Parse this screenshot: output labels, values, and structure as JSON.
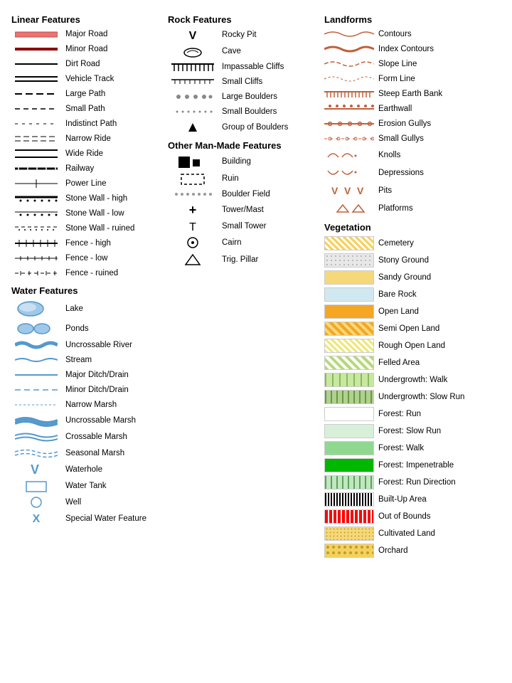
{
  "sections": {
    "linear": {
      "title": "Linear Features",
      "items": [
        {
          "label": "Major Road",
          "sym": "major-road"
        },
        {
          "label": "Minor Road",
          "sym": "minor-road"
        },
        {
          "label": "Dirt Road",
          "sym": "dirt-road"
        },
        {
          "label": "Vehicle Track",
          "sym": "vehicle-track"
        },
        {
          "label": "Large Path",
          "sym": "large-path"
        },
        {
          "label": "Small Path",
          "sym": "small-path"
        },
        {
          "label": "Indistinct Path",
          "sym": "indistinct-path"
        },
        {
          "label": "Narrow Ride",
          "sym": "narrow-ride"
        },
        {
          "label": "Wide Ride",
          "sym": "wide-ride"
        },
        {
          "label": "Railway",
          "sym": "railway"
        },
        {
          "label": "Power Line",
          "sym": "power-line"
        },
        {
          "label": "Stone Wall - high",
          "sym": "stone-high"
        },
        {
          "label": "Stone  Wall - low",
          "sym": "stone-low"
        },
        {
          "label": "Stone  Wall - ruined",
          "sym": "stone-ruined"
        },
        {
          "label": "Fence - high",
          "sym": "fence-high"
        },
        {
          "label": "Fence - low",
          "sym": "fence-low"
        },
        {
          "label": "Fence - ruined",
          "sym": "fence-ruined"
        }
      ]
    },
    "water": {
      "title": "Water Features",
      "items": [
        {
          "label": "Lake",
          "sym": "lake"
        },
        {
          "label": "Ponds",
          "sym": "ponds"
        },
        {
          "label": "Uncrossable River",
          "sym": "uncross-river"
        },
        {
          "label": "Stream",
          "sym": "stream"
        },
        {
          "label": "Major Ditch/Drain",
          "sym": "major-ditch"
        },
        {
          "label": "Minor Ditch/Drain",
          "sym": "minor-ditch"
        },
        {
          "label": "Narrow Marsh",
          "sym": "narrow-marsh"
        },
        {
          "label": "Uncrossable Marsh",
          "sym": "uncross-marsh"
        },
        {
          "label": "Crossable Marsh",
          "sym": "cross-marsh"
        },
        {
          "label": "Seasonal Marsh",
          "sym": "seasonal-marsh"
        },
        {
          "label": "Waterhole",
          "sym": "waterhole"
        },
        {
          "label": "Water Tank",
          "sym": "water-tank"
        },
        {
          "label": "Well",
          "sym": "well"
        },
        {
          "label": "Special Water Feature",
          "sym": "special-water"
        }
      ]
    },
    "rock": {
      "title": "Rock Features",
      "items": [
        {
          "label": "Rocky Pit",
          "sym": "rocky-pit"
        },
        {
          "label": "Cave",
          "sym": "cave"
        },
        {
          "label": "Impassable Cliffs",
          "sym": "impassable"
        },
        {
          "label": "Small Cliffs",
          "sym": "small-cliffs"
        },
        {
          "label": "Large Boulders",
          "sym": "large-boulders"
        },
        {
          "label": "Small Boulders",
          "sym": "small-boulders"
        },
        {
          "label": "Group of Boulders",
          "sym": "group-boulders"
        }
      ]
    },
    "manmade": {
      "title": "Other Man-Made Features",
      "items": [
        {
          "label": "Building",
          "sym": "building"
        },
        {
          "label": "Ruin",
          "sym": "ruin"
        },
        {
          "label": "Boulder Field",
          "sym": "boulder-field"
        },
        {
          "label": "Tower/Mast",
          "sym": "tower"
        },
        {
          "label": "Small Tower",
          "sym": "small-tower"
        },
        {
          "label": "Cairn",
          "sym": "cairn"
        },
        {
          "label": "Trig. Pillar",
          "sym": "trig"
        }
      ]
    },
    "landforms": {
      "title": "Landforms",
      "items": [
        {
          "label": "Contours",
          "sym": "contours"
        },
        {
          "label": "Index Contours",
          "sym": "index-contours"
        },
        {
          "label": "Slope Line",
          "sym": "slope-line"
        },
        {
          "label": "Form Line",
          "sym": "form-line"
        },
        {
          "label": "Steep Earth Bank",
          "sym": "steep-earth"
        },
        {
          "label": "Earthwall",
          "sym": "earthwall"
        },
        {
          "label": "Erosion Gullys",
          "sym": "erosion"
        },
        {
          "label": "Small Gullys",
          "sym": "small-gullys"
        },
        {
          "label": "Knolls",
          "sym": "knolls"
        },
        {
          "label": "Depressions",
          "sym": "depressions"
        },
        {
          "label": "Pits",
          "sym": "pits"
        },
        {
          "label": "Platforms",
          "sym": "platforms"
        }
      ]
    },
    "vegetation": {
      "title": "Vegetation",
      "items": [
        {
          "label": "Cemetery",
          "sym": "cemetery"
        },
        {
          "label": "Stony Ground",
          "sym": "stony"
        },
        {
          "label": "Sandy Ground",
          "sym": "sandy"
        },
        {
          "label": "Bare Rock",
          "sym": "bare-rock"
        },
        {
          "label": "Open Land",
          "sym": "open-land"
        },
        {
          "label": "Semi Open Land",
          "sym": "semi-open"
        },
        {
          "label": "Rough Open Land",
          "sym": "rough-open"
        },
        {
          "label": "Felled Area",
          "sym": "felled"
        },
        {
          "label": "Undergrowth: Walk",
          "sym": "undergrowth-walk"
        },
        {
          "label": "Undergrowth: Slow Run",
          "sym": "undergrowth-slow"
        },
        {
          "label": "Forest: Run",
          "sym": "forest-run"
        },
        {
          "label": "Forest: Slow Run",
          "sym": "forest-slow"
        },
        {
          "label": "Forest: Walk",
          "sym": "forest-walk"
        },
        {
          "label": "Forest: Impenetrable",
          "sym": "forest-imp"
        },
        {
          "label": "Forest: Run Direction",
          "sym": "forest-run-dir"
        },
        {
          "label": "Built-Up Area",
          "sym": "built-up"
        },
        {
          "label": "Out of Bounds",
          "sym": "out-of-bounds"
        },
        {
          "label": "Cultivated Land",
          "sym": "cultivated"
        },
        {
          "label": "Orchard",
          "sym": "orchard"
        }
      ]
    }
  }
}
